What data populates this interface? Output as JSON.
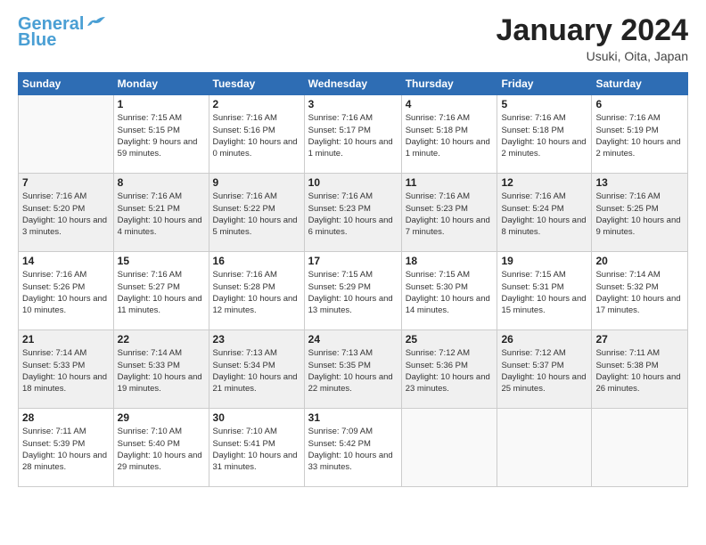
{
  "header": {
    "logo_line1": "General",
    "logo_line2": "Blue",
    "month": "January 2024",
    "location": "Usuki, Oita, Japan"
  },
  "weekdays": [
    "Sunday",
    "Monday",
    "Tuesday",
    "Wednesday",
    "Thursday",
    "Friday",
    "Saturday"
  ],
  "weeks": [
    [
      {
        "day": "",
        "sunrise": "",
        "sunset": "",
        "daylight": ""
      },
      {
        "day": "1",
        "sunrise": "Sunrise: 7:15 AM",
        "sunset": "Sunset: 5:15 PM",
        "daylight": "Daylight: 9 hours and 59 minutes."
      },
      {
        "day": "2",
        "sunrise": "Sunrise: 7:16 AM",
        "sunset": "Sunset: 5:16 PM",
        "daylight": "Daylight: 10 hours and 0 minutes."
      },
      {
        "day": "3",
        "sunrise": "Sunrise: 7:16 AM",
        "sunset": "Sunset: 5:17 PM",
        "daylight": "Daylight: 10 hours and 1 minute."
      },
      {
        "day": "4",
        "sunrise": "Sunrise: 7:16 AM",
        "sunset": "Sunset: 5:18 PM",
        "daylight": "Daylight: 10 hours and 1 minute."
      },
      {
        "day": "5",
        "sunrise": "Sunrise: 7:16 AM",
        "sunset": "Sunset: 5:18 PM",
        "daylight": "Daylight: 10 hours and 2 minutes."
      },
      {
        "day": "6",
        "sunrise": "Sunrise: 7:16 AM",
        "sunset": "Sunset: 5:19 PM",
        "daylight": "Daylight: 10 hours and 2 minutes."
      }
    ],
    [
      {
        "day": "7",
        "sunrise": "Sunrise: 7:16 AM",
        "sunset": "Sunset: 5:20 PM",
        "daylight": "Daylight: 10 hours and 3 minutes."
      },
      {
        "day": "8",
        "sunrise": "Sunrise: 7:16 AM",
        "sunset": "Sunset: 5:21 PM",
        "daylight": "Daylight: 10 hours and 4 minutes."
      },
      {
        "day": "9",
        "sunrise": "Sunrise: 7:16 AM",
        "sunset": "Sunset: 5:22 PM",
        "daylight": "Daylight: 10 hours and 5 minutes."
      },
      {
        "day": "10",
        "sunrise": "Sunrise: 7:16 AM",
        "sunset": "Sunset: 5:23 PM",
        "daylight": "Daylight: 10 hours and 6 minutes."
      },
      {
        "day": "11",
        "sunrise": "Sunrise: 7:16 AM",
        "sunset": "Sunset: 5:23 PM",
        "daylight": "Daylight: 10 hours and 7 minutes."
      },
      {
        "day": "12",
        "sunrise": "Sunrise: 7:16 AM",
        "sunset": "Sunset: 5:24 PM",
        "daylight": "Daylight: 10 hours and 8 minutes."
      },
      {
        "day": "13",
        "sunrise": "Sunrise: 7:16 AM",
        "sunset": "Sunset: 5:25 PM",
        "daylight": "Daylight: 10 hours and 9 minutes."
      }
    ],
    [
      {
        "day": "14",
        "sunrise": "Sunrise: 7:16 AM",
        "sunset": "Sunset: 5:26 PM",
        "daylight": "Daylight: 10 hours and 10 minutes."
      },
      {
        "day": "15",
        "sunrise": "Sunrise: 7:16 AM",
        "sunset": "Sunset: 5:27 PM",
        "daylight": "Daylight: 10 hours and 11 minutes."
      },
      {
        "day": "16",
        "sunrise": "Sunrise: 7:16 AM",
        "sunset": "Sunset: 5:28 PM",
        "daylight": "Daylight: 10 hours and 12 minutes."
      },
      {
        "day": "17",
        "sunrise": "Sunrise: 7:15 AM",
        "sunset": "Sunset: 5:29 PM",
        "daylight": "Daylight: 10 hours and 13 minutes."
      },
      {
        "day": "18",
        "sunrise": "Sunrise: 7:15 AM",
        "sunset": "Sunset: 5:30 PM",
        "daylight": "Daylight: 10 hours and 14 minutes."
      },
      {
        "day": "19",
        "sunrise": "Sunrise: 7:15 AM",
        "sunset": "Sunset: 5:31 PM",
        "daylight": "Daylight: 10 hours and 15 minutes."
      },
      {
        "day": "20",
        "sunrise": "Sunrise: 7:14 AM",
        "sunset": "Sunset: 5:32 PM",
        "daylight": "Daylight: 10 hours and 17 minutes."
      }
    ],
    [
      {
        "day": "21",
        "sunrise": "Sunrise: 7:14 AM",
        "sunset": "Sunset: 5:33 PM",
        "daylight": "Daylight: 10 hours and 18 minutes."
      },
      {
        "day": "22",
        "sunrise": "Sunrise: 7:14 AM",
        "sunset": "Sunset: 5:33 PM",
        "daylight": "Daylight: 10 hours and 19 minutes."
      },
      {
        "day": "23",
        "sunrise": "Sunrise: 7:13 AM",
        "sunset": "Sunset: 5:34 PM",
        "daylight": "Daylight: 10 hours and 21 minutes."
      },
      {
        "day": "24",
        "sunrise": "Sunrise: 7:13 AM",
        "sunset": "Sunset: 5:35 PM",
        "daylight": "Daylight: 10 hours and 22 minutes."
      },
      {
        "day": "25",
        "sunrise": "Sunrise: 7:12 AM",
        "sunset": "Sunset: 5:36 PM",
        "daylight": "Daylight: 10 hours and 23 minutes."
      },
      {
        "day": "26",
        "sunrise": "Sunrise: 7:12 AM",
        "sunset": "Sunset: 5:37 PM",
        "daylight": "Daylight: 10 hours and 25 minutes."
      },
      {
        "day": "27",
        "sunrise": "Sunrise: 7:11 AM",
        "sunset": "Sunset: 5:38 PM",
        "daylight": "Daylight: 10 hours and 26 minutes."
      }
    ],
    [
      {
        "day": "28",
        "sunrise": "Sunrise: 7:11 AM",
        "sunset": "Sunset: 5:39 PM",
        "daylight": "Daylight: 10 hours and 28 minutes."
      },
      {
        "day": "29",
        "sunrise": "Sunrise: 7:10 AM",
        "sunset": "Sunset: 5:40 PM",
        "daylight": "Daylight: 10 hours and 29 minutes."
      },
      {
        "day": "30",
        "sunrise": "Sunrise: 7:10 AM",
        "sunset": "Sunset: 5:41 PM",
        "daylight": "Daylight: 10 hours and 31 minutes."
      },
      {
        "day": "31",
        "sunrise": "Sunrise: 7:09 AM",
        "sunset": "Sunset: 5:42 PM",
        "daylight": "Daylight: 10 hours and 33 minutes."
      },
      {
        "day": "",
        "sunrise": "",
        "sunset": "",
        "daylight": ""
      },
      {
        "day": "",
        "sunrise": "",
        "sunset": "",
        "daylight": ""
      },
      {
        "day": "",
        "sunrise": "",
        "sunset": "",
        "daylight": ""
      }
    ]
  ]
}
